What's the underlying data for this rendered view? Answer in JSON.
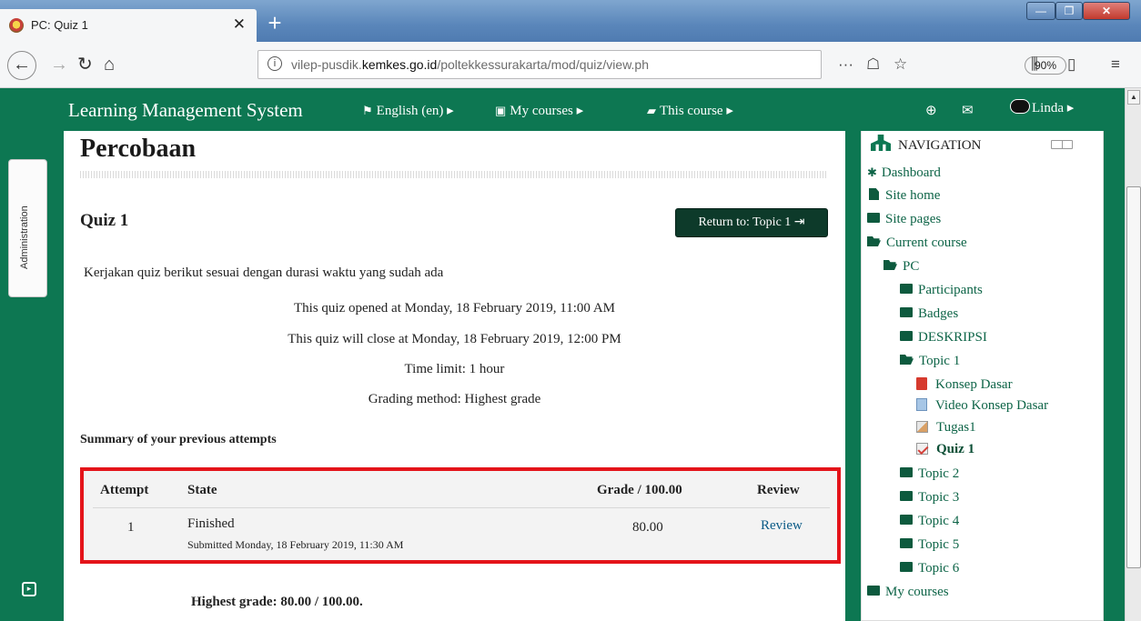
{
  "browser": {
    "tab_title": "PC: Quiz 1",
    "new_tab": "+",
    "url_prefix": "vilep-pusdik.",
    "url_domain": "kemkes.go.id",
    "url_path": "/poltekkessurakarta/mod/quiz/view.ph",
    "zoom": "90%",
    "window_buttons": {
      "minimize": "—",
      "maximize": "❐",
      "close": "✕"
    }
  },
  "navbar": {
    "brand": "Learning Management System",
    "language": "English (en)",
    "my_courses": "My courses",
    "this_course": "This course",
    "user": "Linda"
  },
  "sidebar_drawer": {
    "label": "Administration"
  },
  "page": {
    "heading": "Percobaan",
    "quiz_title": "Quiz 1",
    "return_button": "Return to: Topic 1",
    "intro": "Kerjakan quiz berikut sesuai dengan durasi waktu yang sudah ada",
    "info": [
      "This quiz opened at Monday, 18 February 2019, 11:00 AM",
      "This quiz will close at Monday, 18 February 2019, 12:00 PM",
      "Time limit: 1 hour",
      "Grading method: Highest grade"
    ],
    "summary_title": "Summary of your previous attempts",
    "table": {
      "headers": [
        "Attempt",
        "State",
        "Grade / 100.00",
        "Review"
      ],
      "rows": [
        {
          "attempt": "1",
          "state": "Finished",
          "submitted": "Submitted Monday, 18 February 2019, 11:30 AM",
          "grade": "80.00",
          "review": "Review"
        }
      ]
    },
    "highest_grade": "Highest grade: 80.00 / 100.00."
  },
  "navigation": {
    "title": "NAVIGATION",
    "items": [
      "Dashboard",
      "Site home",
      "Site pages",
      "Current course",
      "PC",
      "Participants",
      "Badges",
      "DESKRIPSI",
      "Topic 1",
      "Konsep Dasar",
      "Video Konsep Dasar",
      "Tugas1",
      "Quiz 1",
      "Topic 2",
      "Topic 3",
      "Topic 4",
      "Topic 5",
      "Topic 6",
      "My courses"
    ]
  },
  "colors": {
    "brand_green": "#0d7752",
    "highlight_red": "#e4141a",
    "button_dark": "#0d3a2a"
  }
}
